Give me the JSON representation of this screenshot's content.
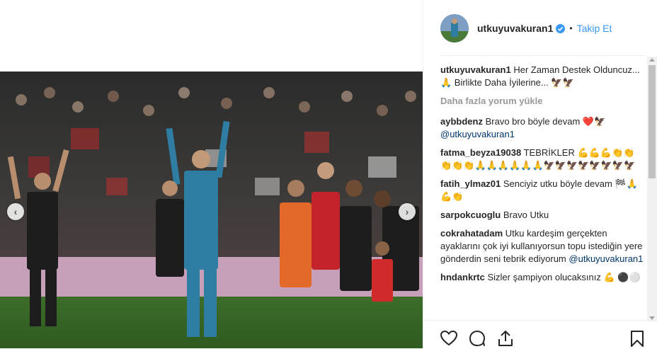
{
  "post": {
    "username": "utkuyuvakuran1",
    "follow_label": "Takip Et",
    "dot": "•",
    "caption_user": "utkuyuvakuran1",
    "caption_text": "Her Zaman Destek Olduncuz... 🙏 Birlikte Daha İyilerine... 🦅🦅",
    "load_more": "Daha fazla yorum yükle"
  },
  "comments": [
    {
      "user": "aybbdenz",
      "text": "Bravo bro böyle devam ❤️🦅",
      "mention": "@utkuyuvakuran1"
    },
    {
      "user": "fatma_beyza19038",
      "text": "TEBRİKLER 💪💪💪👏👏👏👏👏🙏🙏🙏🙏🙏🙏🦅🦅🦅🦅🦅🦅🦅🦅",
      "mention": ""
    },
    {
      "user": "fatih_ylmaz01",
      "text": "Senciyiz utku böyle devam 🏁🙏💪👏",
      "mention": ""
    },
    {
      "user": "sarpokcuoglu",
      "text": "Bravo Utku",
      "mention": ""
    },
    {
      "user": "cokrahatadam",
      "text": "Utku kardeşim gerçekten ayaklarını çok iyi kullanıyorsun topu istediğin yere gönderdin seni tebrik ediyorum",
      "mention": "@utkuyuvakuran1"
    },
    {
      "user": "hndankrtc",
      "text": "Sizler şampiyon olucaksınız 💪 ⚫⚪",
      "mention": ""
    }
  ],
  "colors": {
    "link": "#3897f0",
    "mention": "#003569",
    "text": "#262626",
    "muted": "#999999"
  },
  "icons": [
    "chevron-left-icon",
    "chevron-right-icon",
    "verified-badge-icon",
    "heart-icon",
    "comment-icon",
    "share-icon",
    "bookmark-icon"
  ]
}
